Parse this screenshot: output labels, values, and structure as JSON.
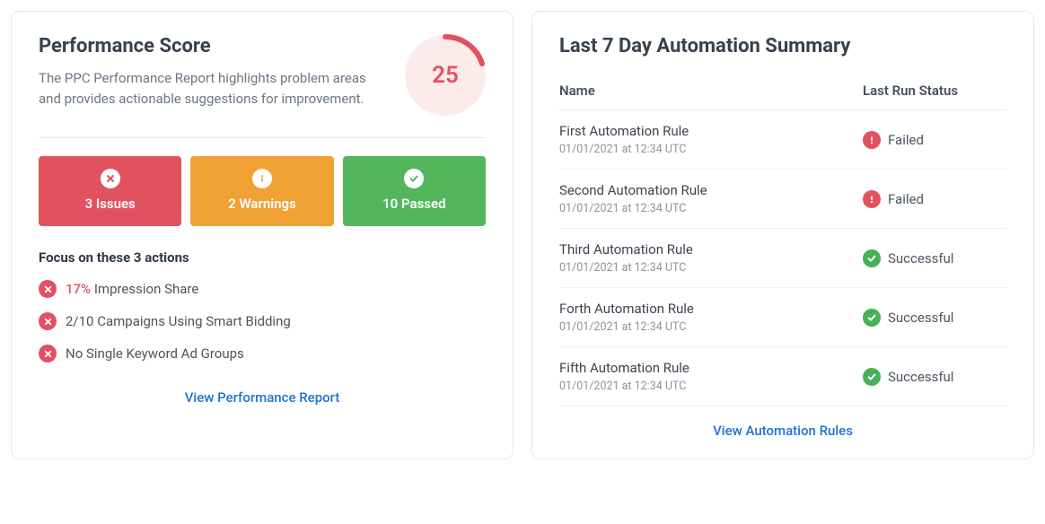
{
  "performance": {
    "title": "Performance Score",
    "description": "The PPC Performance Report highlights problem areas and provides actionable suggestions for improvement.",
    "score": "25",
    "issues_label": "3 Issues",
    "warnings_label": "2 Warnings",
    "passed_label": "10 Passed",
    "focus_title": "Focus on these 3 actions",
    "actions": [
      {
        "highlight": "17%",
        "rest": " Impression Share"
      },
      {
        "highlight": "",
        "rest": "2/10 Campaigns Using Smart Bidding"
      },
      {
        "highlight": "",
        "rest": "No Single Keyword Ad Groups"
      }
    ],
    "view_link": "View Performance Report"
  },
  "automation": {
    "title": "Last 7 Day Automation Summary",
    "col_name": "Name",
    "col_status": "Last Run Status",
    "status_failed_label": "Failed",
    "status_success_label": "Successful",
    "rows": [
      {
        "name": "First Automation Rule",
        "timestamp": "01/01/2021 at 12:34 UTC",
        "status": "failed"
      },
      {
        "name": "Second Automation Rule",
        "timestamp": "01/01/2021 at 12:34 UTC",
        "status": "failed"
      },
      {
        "name": "Third Automation Rule",
        "timestamp": "01/01/2021 at 12:34 UTC",
        "status": "successful"
      },
      {
        "name": "Forth Automation Rule",
        "timestamp": "01/01/2021 at 12:34 UTC",
        "status": "successful"
      },
      {
        "name": "Fifth Automation Rule",
        "timestamp": "01/01/2021 at 12:34 UTC",
        "status": "successful"
      }
    ],
    "view_link": "View Automation Rules"
  },
  "colors": {
    "red": "#e15261",
    "orange": "#f0a134",
    "green": "#52b75c",
    "link": "#1e73d4"
  }
}
